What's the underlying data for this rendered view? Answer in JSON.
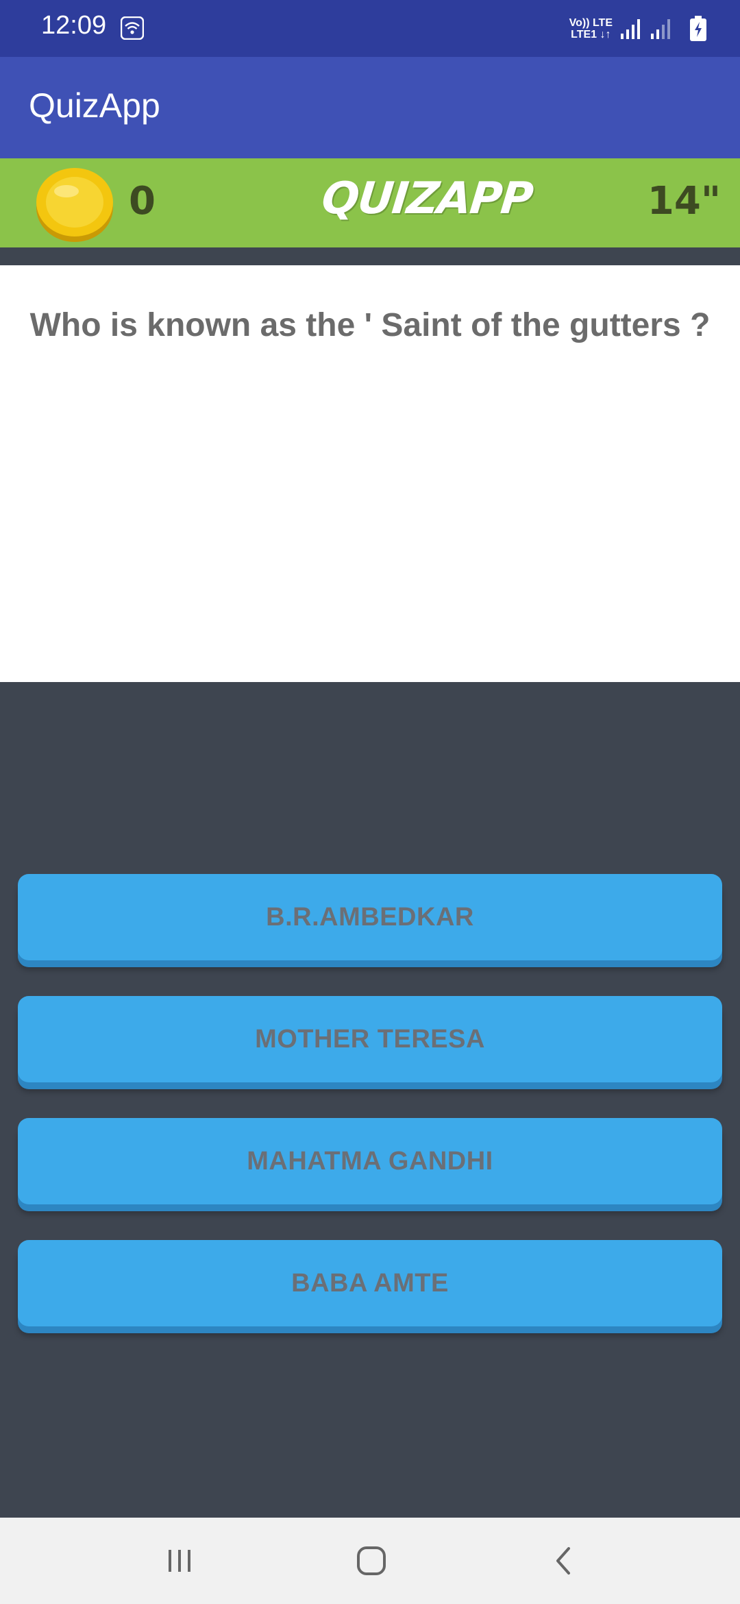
{
  "status_bar": {
    "time": "12:09",
    "net_top": "Vo)) LTE",
    "net_bottom": "LTE1 ↓↑"
  },
  "app_bar": {
    "title": "QuizApp"
  },
  "score_bar": {
    "coins": "0",
    "brand": "QUIZAPP",
    "timer": "14\""
  },
  "question": {
    "text": "Who is known as the ' Saint of the gutters ?"
  },
  "answers": [
    {
      "label": "B.R.AMBEDKAR"
    },
    {
      "label": "MOTHER TERESA"
    },
    {
      "label": "MAHATMA GANDHI"
    },
    {
      "label": "BABA AMTE"
    }
  ],
  "nav": {
    "recents_icon": "recents-icon",
    "home_icon": "home-icon",
    "back_icon": "back-icon"
  },
  "colors": {
    "status_bar": "#2e3d9c",
    "app_bar": "#3f51b5",
    "score_bar": "#8bc34a",
    "background": "#3e4550",
    "answer_button": "#3daaea",
    "answer_text": "#6b6f76",
    "question_text": "#6b6b6b"
  }
}
